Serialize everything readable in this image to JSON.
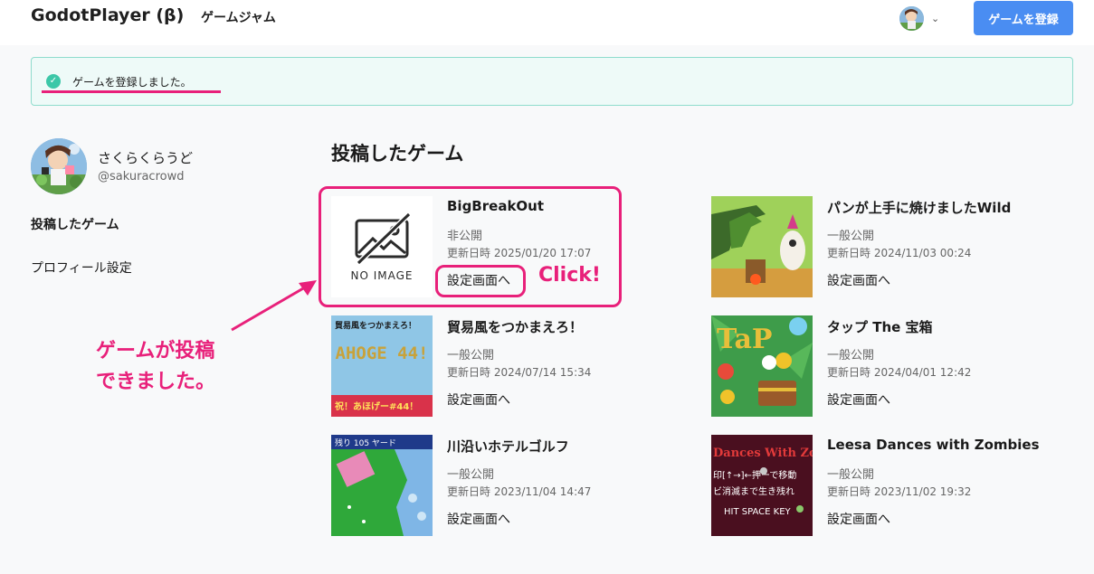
{
  "header": {
    "brand": "GodotPlayer (β)",
    "nav_jam": "ゲームジャム",
    "register_button": "ゲームを登録",
    "chevron": "⌄"
  },
  "flash": {
    "message": "ゲームを登録しました。",
    "icon": "check-circle-icon",
    "color": "#3cc7a8"
  },
  "profile": {
    "name": "さくらくらうど",
    "handle": "@sakuracrowd"
  },
  "sidebar": {
    "posted_games": "投稿したゲーム",
    "profile_settings": "プロフィール設定"
  },
  "main": {
    "title": "投稿したゲーム",
    "settings_label": "設定画面へ",
    "games": [
      {
        "title": "BigBreakOut",
        "status": "非公開",
        "updated": "更新日時 2025/01/20 17:07",
        "thumb_text": "NO IMAGE"
      },
      {
        "title": "パンが上手に焼けましたWild",
        "status": "一般公開",
        "updated": "更新日時 2024/11/03 00:24"
      },
      {
        "title": "貿易風をつかまえろ！",
        "status": "一般公開",
        "updated": "更新日時 2024/07/14 15:34",
        "thumb_text": "貿易風をつかまえろ！",
        "thumb_banner": "祝！あほげー#44！",
        "thumb_big": "AHOGE 44!"
      },
      {
        "title": "タップ The 宝箱",
        "status": "一般公開",
        "updated": "更新日時 2024/04/01 12:42",
        "thumb_text": "TaP"
      },
      {
        "title": "川沿いホテルゴルフ",
        "status": "一般公開",
        "updated": "更新日時 2023/11/04 14:47",
        "thumb_text": "残り 105 ヤード"
      },
      {
        "title": "Leesa Dances with Zombies",
        "status": "一般公開",
        "updated": "更新日時 2023/11/02 19:32",
        "thumb_text": "Dances With Zo",
        "thumb_line2": "印[↑→]←押ーで移動",
        "thumb_line3": "ビ消滅まで生き残れ",
        "thumb_line4": "HIT SPACE KEY"
      }
    ]
  },
  "annotations": {
    "click": "Click!",
    "posted_line1": "ゲームが投稿",
    "posted_line2": "できました。",
    "color": "#e8207a"
  }
}
